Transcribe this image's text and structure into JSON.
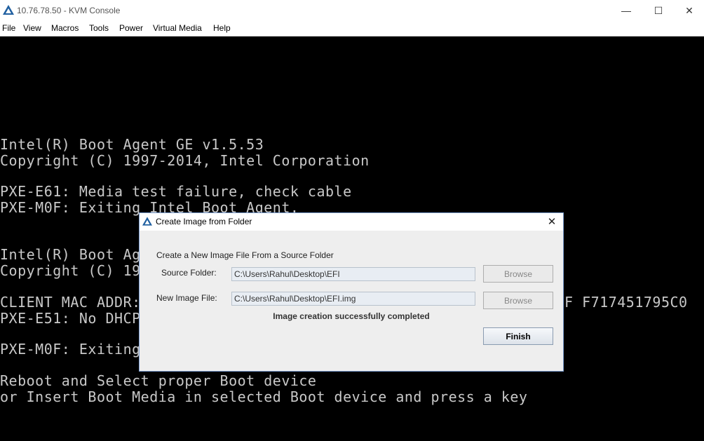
{
  "window": {
    "title": "10.76.78.50 - KVM Console",
    "controls": {
      "minimize": "—",
      "maximize": "☐",
      "close": "✕"
    }
  },
  "menu": [
    "File",
    "View",
    "Macros",
    "Tools",
    "Power",
    "Virtual Media",
    "Help"
  ],
  "console_lines": [
    "Intel(R) Boot Agent GE v1.5.53",
    "Copyright (C) 1997-2014, Intel Corporation",
    "PXE-E61: Media test failure, check cable",
    "PXE-M0F: Exiting Intel Boot Agent.",
    "Intel(R) Boot Ag",
    "Copyright (C) 19",
    "CLIENT MAC ADDR:",
    "F F717451795C0",
    "PXE-E51: No DHCP",
    "PXE-M0F: Exiting",
    "Reboot and Select proper Boot device",
    "or Insert Boot Media in selected Boot device and press a key"
  ],
  "dialog": {
    "title": "Create Image from Folder",
    "heading": "Create a New Image File From a Source Folder",
    "source_label": "Source Folder:",
    "source_value": "C:\\Users\\Rahul\\Desktop\\EFI",
    "image_label": "New Image File:",
    "image_value": "C:\\Users\\Rahul\\Desktop\\EFI.img",
    "browse_label": "Browse",
    "status": "Image creation successfully completed",
    "finish_label": "Finish",
    "close_glyph": "✕"
  },
  "colors": {
    "console_bg": "#000000",
    "console_text": "#c8c8c8",
    "dialog_border": "#7a9ccf",
    "icon_blue": "#1f5fa0"
  }
}
